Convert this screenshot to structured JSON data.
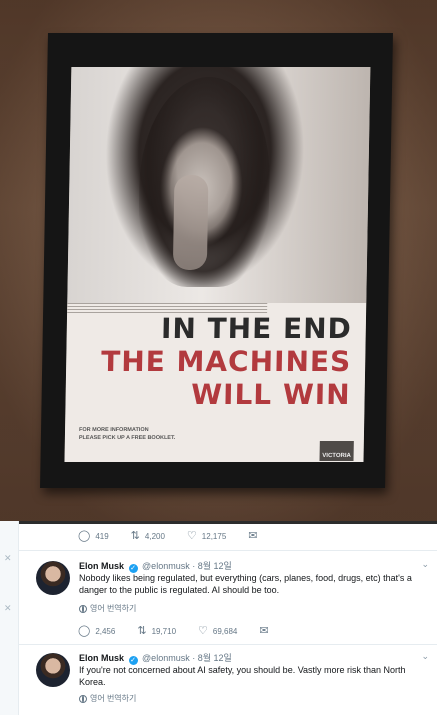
{
  "poster": {
    "line1": "IN THE END",
    "line2": "THE MACHINES",
    "line3": "WILL WIN",
    "fine1": "FOR MORE INFORMATION",
    "fine2": "PLEASE PICK UP A FREE BOOKLET.",
    "logo_text": "VICTORIA",
    "colors": {
      "headline_dark": "#2b2b2b",
      "headline_red": "#b23a3e"
    }
  },
  "tweet0": {
    "actions": {
      "replies": "419",
      "retweets": "4,200",
      "likes": "12,175"
    }
  },
  "tweet1": {
    "name": "Elon Musk",
    "handle": "@elonmusk",
    "date": "· 8월 12일",
    "text": "Nobody likes being regulated, but everything (cars, planes, food, drugs, etc) that's a danger to the public is regulated. AI should be too.",
    "translate": "영어 번역하기",
    "actions": {
      "replies": "2,456",
      "retweets": "19,710",
      "likes": "69,684"
    }
  },
  "tweet2": {
    "name": "Elon Musk",
    "handle": "@elonmusk",
    "date": "· 8월 12일",
    "text": "If you're not concerned about AI safety, you should be. Vastly more risk than North Korea.",
    "translate": "영어 번역하기"
  },
  "icons": {
    "reply": "reply-icon",
    "retweet": "retweet-icon",
    "like": "heart-icon",
    "dm": "envelope-icon",
    "verified": "verified-badge-icon",
    "more": "chevron-down-icon",
    "translate": "globe-icon",
    "dismiss": "close-icon"
  },
  "colors": {
    "accent": "#1da1f2",
    "text": "#14171a",
    "muted": "#657786"
  }
}
